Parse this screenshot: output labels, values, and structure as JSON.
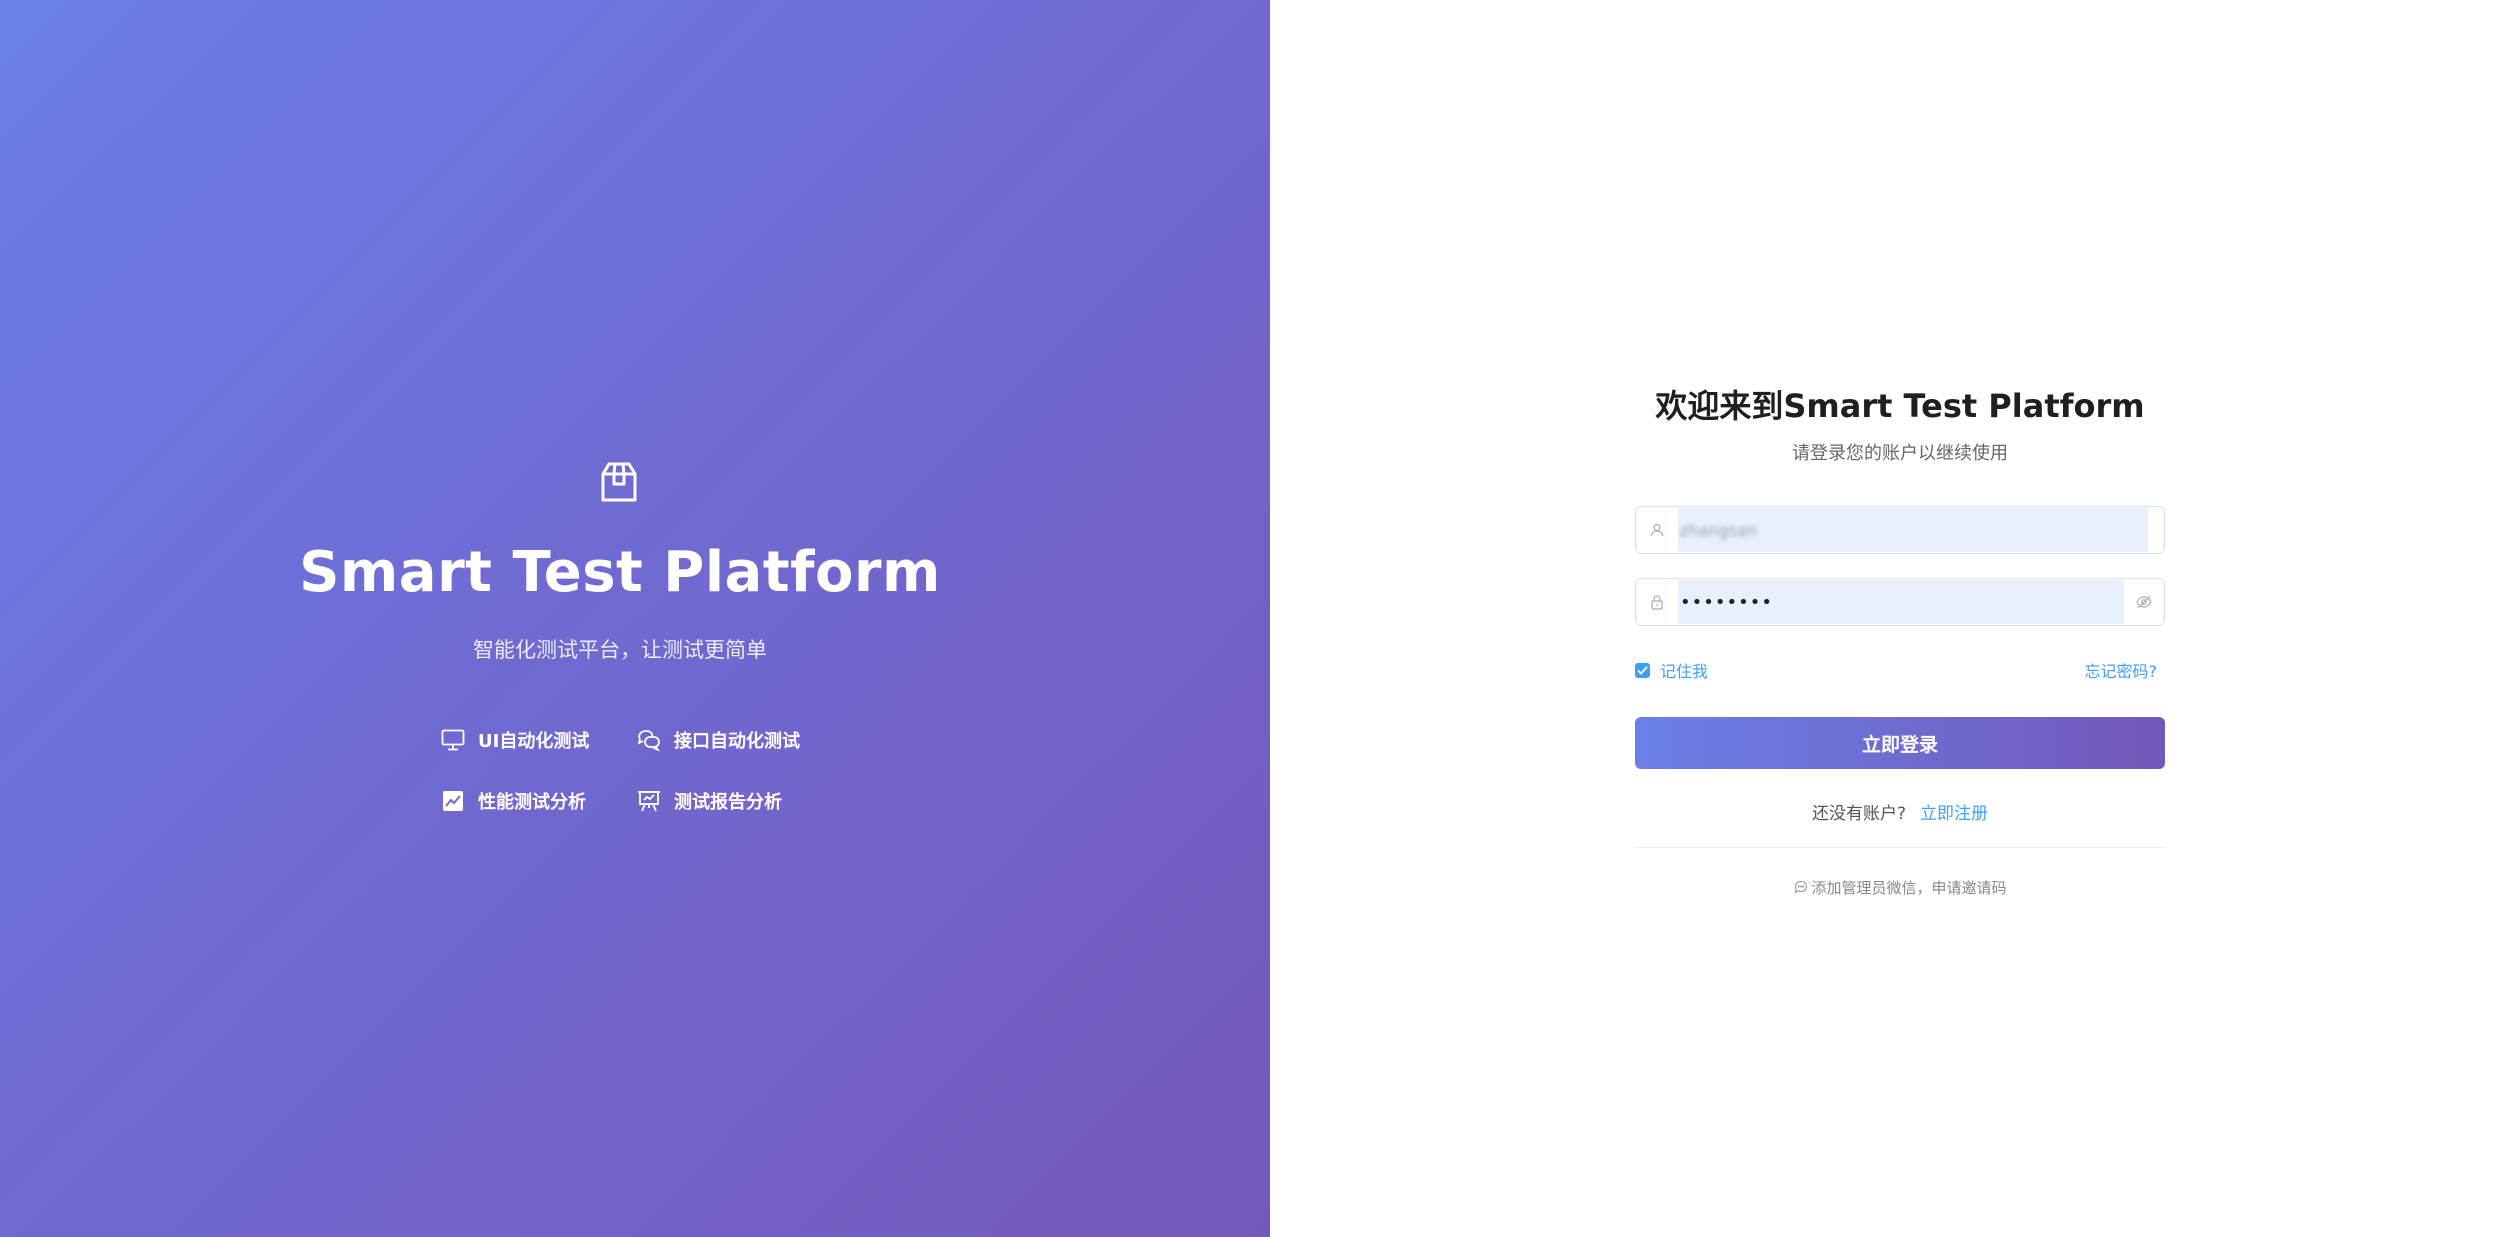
{
  "brand": {
    "logo_icon": "package-box-icon",
    "title": "Smart Test Platform",
    "subtitle": "智能化测试平台，让测试更简单",
    "features": [
      {
        "icon": "monitor-icon",
        "label": "UI自动化测试"
      },
      {
        "icon": "chat-bubbles-icon",
        "label": "接口自动化测试"
      },
      {
        "icon": "line-chart-icon",
        "label": "性能测试分析"
      },
      {
        "icon": "presentation-board-icon",
        "label": "测试报告分析"
      }
    ],
    "gradient_start": "#6a80e8",
    "gradient_end": "#7459b8"
  },
  "login": {
    "title": "欢迎来到Smart Test Platform",
    "subtitle": "请登录您的账户以继续使用",
    "username": {
      "icon": "user-icon",
      "value": "zhangsan"
    },
    "password": {
      "icon": "lock-icon",
      "value": "••••••••",
      "toggle_icon": "eye-hidden-icon"
    },
    "remember_label": "记住我",
    "remember_checked": true,
    "forgot_label": "忘记密码?",
    "submit_label": "立即登录",
    "no_account_text": "还没有账户?",
    "register_label": "立即注册",
    "footer_icon": "chat-icon",
    "footer_tip": "添加管理员微信，申请邀请码",
    "accent_color": "#409eff"
  }
}
